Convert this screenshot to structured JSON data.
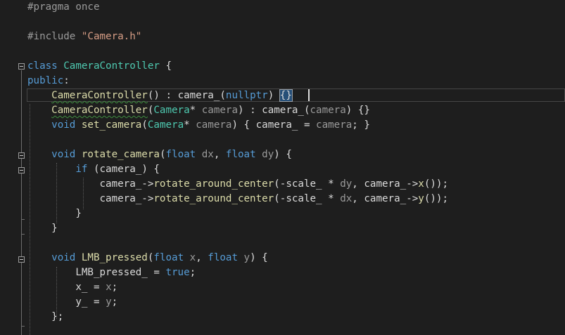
{
  "editor": {
    "theme_colors": {
      "background": "#1e1e1e",
      "keyword": "#569cd6",
      "type": "#4ec9b0",
      "function": "#dcdcaa",
      "string": "#d69d85",
      "preprocessor": "#9b9b9b",
      "parameter": "#9a9a9a",
      "text": "#dcdcdc"
    },
    "fold_icon": "minus-square-icon",
    "lines": [
      [
        {
          "t": "#pragma once",
          "c": "pre"
        }
      ],
      [],
      [
        {
          "t": "#include ",
          "c": "pre"
        },
        {
          "t": "\"Camera.h\"",
          "c": "string"
        }
      ],
      [],
      [
        {
          "t": "class ",
          "c": "keyword"
        },
        {
          "t": "CameraController",
          "c": "type"
        },
        {
          "t": " {",
          "c": "plain"
        }
      ],
      [
        {
          "t": "public",
          "c": "keyword"
        },
        {
          "t": ":",
          "c": "plain"
        }
      ],
      [
        {
          "t": "    ",
          "c": "plain"
        },
        {
          "t": "CameraController",
          "c": "func squiggle"
        },
        {
          "t": "() : ",
          "c": "plain"
        },
        {
          "t": "camera_",
          "c": "member"
        },
        {
          "t": "(",
          "c": "plain"
        },
        {
          "t": "nullptr",
          "c": "keyword"
        },
        {
          "t": ") ",
          "c": "plain"
        },
        {
          "t": "{}",
          "c": "plain bracehl"
        }
      ],
      [
        {
          "t": "    ",
          "c": "plain"
        },
        {
          "t": "CameraController",
          "c": "func squiggle"
        },
        {
          "t": "(",
          "c": "plain"
        },
        {
          "t": "Camera",
          "c": "type"
        },
        {
          "t": "* ",
          "c": "plain"
        },
        {
          "t": "camera",
          "c": "param"
        },
        {
          "t": ") : ",
          "c": "plain"
        },
        {
          "t": "camera_",
          "c": "member"
        },
        {
          "t": "(",
          "c": "plain"
        },
        {
          "t": "camera",
          "c": "param"
        },
        {
          "t": ") {}",
          "c": "plain"
        }
      ],
      [
        {
          "t": "    ",
          "c": "plain"
        },
        {
          "t": "void ",
          "c": "keyword"
        },
        {
          "t": "set_camera",
          "c": "func"
        },
        {
          "t": "(",
          "c": "plain"
        },
        {
          "t": "Camera",
          "c": "type"
        },
        {
          "t": "* ",
          "c": "plain"
        },
        {
          "t": "camera",
          "c": "param"
        },
        {
          "t": ") { ",
          "c": "plain"
        },
        {
          "t": "camera_",
          "c": "member"
        },
        {
          "t": " = ",
          "c": "plain"
        },
        {
          "t": "camera",
          "c": "param"
        },
        {
          "t": "; }",
          "c": "plain"
        }
      ],
      [],
      [
        {
          "t": "    ",
          "c": "plain"
        },
        {
          "t": "void ",
          "c": "keyword"
        },
        {
          "t": "rotate_camera",
          "c": "func"
        },
        {
          "t": "(",
          "c": "plain"
        },
        {
          "t": "float ",
          "c": "keyword"
        },
        {
          "t": "dx",
          "c": "param"
        },
        {
          "t": ", ",
          "c": "plain"
        },
        {
          "t": "float ",
          "c": "keyword"
        },
        {
          "t": "dy",
          "c": "param"
        },
        {
          "t": ") {",
          "c": "plain"
        }
      ],
      [
        {
          "t": "        ",
          "c": "plain"
        },
        {
          "t": "if ",
          "c": "keyword"
        },
        {
          "t": "(",
          "c": "plain"
        },
        {
          "t": "camera_",
          "c": "member"
        },
        {
          "t": ") {",
          "c": "plain"
        }
      ],
      [
        {
          "t": "            ",
          "c": "plain"
        },
        {
          "t": "camera_",
          "c": "member"
        },
        {
          "t": "->",
          "c": "plain"
        },
        {
          "t": "rotate_around_center",
          "c": "func"
        },
        {
          "t": "(-",
          "c": "plain"
        },
        {
          "t": "scale_",
          "c": "member"
        },
        {
          "t": " * ",
          "c": "plain"
        },
        {
          "t": "dy",
          "c": "param"
        },
        {
          "t": ", ",
          "c": "plain"
        },
        {
          "t": "camera_",
          "c": "member"
        },
        {
          "t": "->",
          "c": "plain"
        },
        {
          "t": "x",
          "c": "func"
        },
        {
          "t": "());",
          "c": "plain"
        }
      ],
      [
        {
          "t": "            ",
          "c": "plain"
        },
        {
          "t": "camera_",
          "c": "member"
        },
        {
          "t": "->",
          "c": "plain"
        },
        {
          "t": "rotate_around_center",
          "c": "func"
        },
        {
          "t": "(-",
          "c": "plain"
        },
        {
          "t": "scale_",
          "c": "member"
        },
        {
          "t": " * ",
          "c": "plain"
        },
        {
          "t": "dx",
          "c": "param"
        },
        {
          "t": ", ",
          "c": "plain"
        },
        {
          "t": "camera_",
          "c": "member"
        },
        {
          "t": "->",
          "c": "plain"
        },
        {
          "t": "y",
          "c": "func"
        },
        {
          "t": "());",
          "c": "plain"
        }
      ],
      [
        {
          "t": "        }",
          "c": "plain"
        }
      ],
      [
        {
          "t": "    }",
          "c": "plain"
        }
      ],
      [],
      [
        {
          "t": "    ",
          "c": "plain"
        },
        {
          "t": "void ",
          "c": "keyword"
        },
        {
          "t": "LMB_pressed",
          "c": "func"
        },
        {
          "t": "(",
          "c": "plain"
        },
        {
          "t": "float ",
          "c": "keyword"
        },
        {
          "t": "x",
          "c": "param"
        },
        {
          "t": ", ",
          "c": "plain"
        },
        {
          "t": "float ",
          "c": "keyword"
        },
        {
          "t": "y",
          "c": "param"
        },
        {
          "t": ") {",
          "c": "plain"
        }
      ],
      [
        {
          "t": "        ",
          "c": "plain"
        },
        {
          "t": "LMB_pressed_",
          "c": "member"
        },
        {
          "t": " = ",
          "c": "plain"
        },
        {
          "t": "true",
          "c": "keyword"
        },
        {
          "t": ";",
          "c": "plain"
        }
      ],
      [
        {
          "t": "        ",
          "c": "plain"
        },
        {
          "t": "x_",
          "c": "member"
        },
        {
          "t": " = ",
          "c": "plain"
        },
        {
          "t": "x",
          "c": "param"
        },
        {
          "t": ";",
          "c": "plain"
        }
      ],
      [
        {
          "t": "        ",
          "c": "plain"
        },
        {
          "t": "y_",
          "c": "member"
        },
        {
          "t": " = ",
          "c": "plain"
        },
        {
          "t": "y",
          "c": "param"
        },
        {
          "t": ";",
          "c": "plain"
        }
      ],
      [
        {
          "t": "    };",
          "c": "plain"
        }
      ]
    ]
  }
}
